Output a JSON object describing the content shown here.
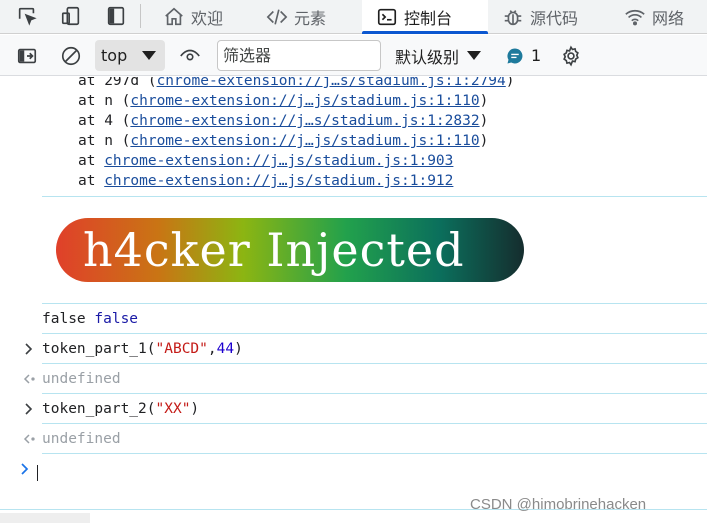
{
  "tabbar": {
    "tabs": [
      {
        "label": "欢迎",
        "icon": "home-icon"
      },
      {
        "label": "元素",
        "icon": "code-icon"
      },
      {
        "label": "控制台",
        "icon": "console-icon",
        "active": true
      },
      {
        "label": "源代码",
        "icon": "bug-icon"
      },
      {
        "label": "网络",
        "icon": "wifi-icon"
      }
    ],
    "tools": [
      "inspect-cursor-icon",
      "device-toolbar-icon",
      "dock-side-icon"
    ]
  },
  "toolbar": {
    "context": "top",
    "filter_placeholder": "筛选器",
    "levels_label": "默认级别",
    "issues_count": "1"
  },
  "console": {
    "stack": [
      {
        "prefix": "at 297d (",
        "link": "chrome-extension://j…s/stadium.js:1:2794",
        "suffix": ")"
      },
      {
        "prefix": "at n (",
        "link": "chrome-extension://j…js/stadium.js:1:110",
        "suffix": ")"
      },
      {
        "prefix": "at 4 (",
        "link": "chrome-extension://j…s/stadium.js:1:2832",
        "suffix": ")"
      },
      {
        "prefix": "at n (",
        "link": "chrome-extension://j…js/stadium.js:1:110",
        "suffix": ")"
      },
      {
        "prefix": "at ",
        "link": "chrome-extension://j…js/stadium.js:1:903",
        "suffix": ""
      },
      {
        "prefix": "at ",
        "link": "chrome-extension://j…js/stadium.js:1:912",
        "suffix": ""
      }
    ],
    "banner_text": "h4cker Injected",
    "log_values": [
      "false",
      "false"
    ],
    "call1": {
      "fn": "token_part_1(",
      "arg_str": "\"ABCD\"",
      "comma": ",",
      "arg_num": "44",
      "close": ")"
    },
    "result1": "undefined",
    "call2": {
      "fn": "token_part_2(",
      "arg_str": "\"XX\"",
      "close": ")"
    },
    "result2": "undefined"
  },
  "watermark": "CSDN @himobrinehacken",
  "colors": {
    "accent": "#0b57d0",
    "link": "#1a4d9c",
    "string": "#c41a16",
    "number": "#1c00cf",
    "separator": "#b7e4f0"
  }
}
